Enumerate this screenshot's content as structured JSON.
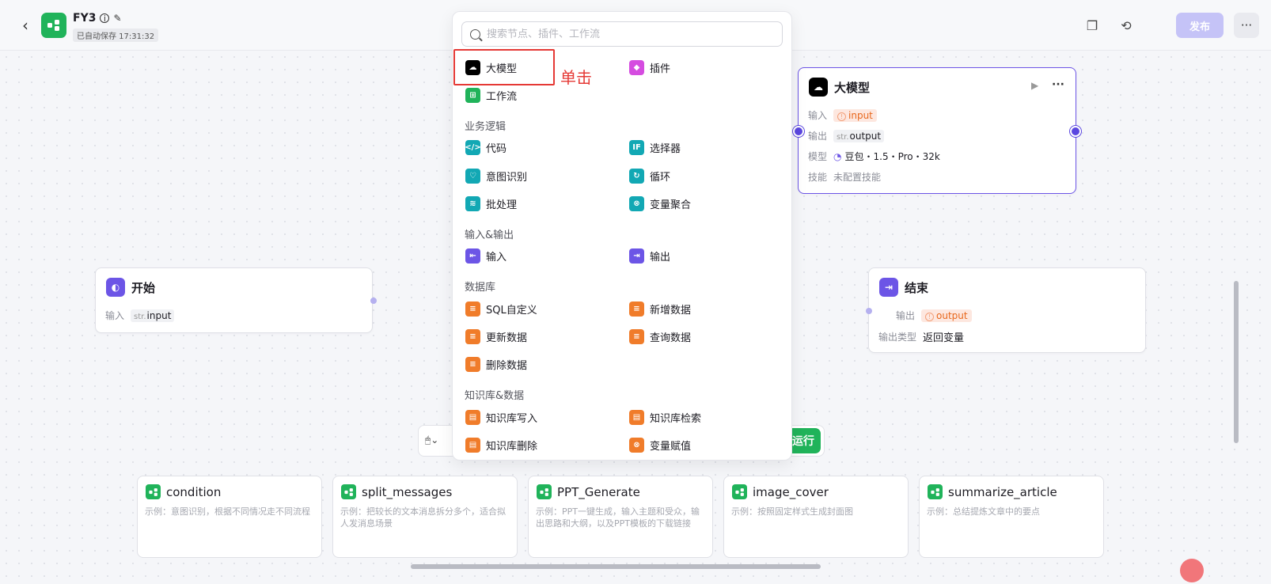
{
  "header": {
    "back_icon": "chevron-left-icon",
    "app_icon": "workflow-icon",
    "title": "FY3",
    "autosave": "已自动保存 17:31:32",
    "publish_label": "发布",
    "more_label": "···"
  },
  "search": {
    "placeholder": "搜索节点、插件、工作流"
  },
  "menu": {
    "top": [
      {
        "label": "大模型",
        "icon": "llm-icon",
        "color": "#000000"
      },
      {
        "label": "插件",
        "icon": "plugin-icon",
        "color": "#d54ce0"
      },
      {
        "label": "工作流",
        "icon": "workflow-icon",
        "color": "#20b35a"
      }
    ],
    "sections": [
      {
        "title": "业务逻辑",
        "items": [
          {
            "label": "代码",
            "icon": "code-icon",
            "color": "#12a8b4"
          },
          {
            "label": "选择器",
            "icon": "if-icon",
            "color": "#12a8b4"
          },
          {
            "label": "意图识别",
            "icon": "intent-icon",
            "color": "#12a8b4"
          },
          {
            "label": "循环",
            "icon": "loop-icon",
            "color": "#12a8b4"
          },
          {
            "label": "批处理",
            "icon": "batch-icon",
            "color": "#12a8b4"
          },
          {
            "label": "变量聚合",
            "icon": "variable-merge-icon",
            "color": "#12a8b4"
          }
        ]
      },
      {
        "title": "输入&输出",
        "items": [
          {
            "label": "输入",
            "icon": "input-icon",
            "color": "#6c55e6"
          },
          {
            "label": "输出",
            "icon": "output-icon",
            "color": "#6c55e6"
          }
        ]
      },
      {
        "title": "数据库",
        "items": [
          {
            "label": "SQL自定义",
            "icon": "database-icon",
            "color": "#f07c2a"
          },
          {
            "label": "新增数据",
            "icon": "database-add-icon",
            "color": "#f07c2a"
          },
          {
            "label": "更新数据",
            "icon": "database-update-icon",
            "color": "#f07c2a"
          },
          {
            "label": "查询数据",
            "icon": "database-query-icon",
            "color": "#f07c2a"
          },
          {
            "label": "删除数据",
            "icon": "database-delete-icon",
            "color": "#f07c2a"
          }
        ]
      },
      {
        "title": "知识库&数据",
        "items": [
          {
            "label": "知识库写入",
            "icon": "knowledge-write-icon",
            "color": "#f07c2a"
          },
          {
            "label": "知识库检索",
            "icon": "knowledge-search-icon",
            "color": "#f07c2a"
          },
          {
            "label": "知识库删除",
            "icon": "knowledge-delete-icon",
            "color": "#f07c2a"
          },
          {
            "label": "变量赋值",
            "icon": "variable-assign-icon",
            "color": "#f07c2a"
          }
        ]
      }
    ]
  },
  "annotation": {
    "label": "单击"
  },
  "nodes": {
    "start": {
      "title": "开始",
      "input_label": "输入",
      "input_type": "str.",
      "input_name": "input"
    },
    "llm": {
      "title": "大模型",
      "input_label": "输入",
      "input_name": "input",
      "output_label": "输出",
      "output_type": "str.",
      "output_name": "output",
      "model_label": "模型",
      "model_value": "豆包・1.5・Pro・32k",
      "skill_label": "技能",
      "skill_value": "未配置技能"
    },
    "end": {
      "title": "结束",
      "output_label": "输出",
      "output_name": "output",
      "type_label": "输出类型",
      "type_value": "返回变量"
    }
  },
  "toolbar": {
    "run_label": "运行"
  },
  "templates": [
    {
      "title": "condition",
      "desc": "示例：意图识别，根据不同情况走不同流程"
    },
    {
      "title": "split_messages",
      "desc": "示例：把较长的文本消息拆分多个，适合拟人发消息场景"
    },
    {
      "title": "PPT_Generate",
      "desc": "示例：PPT一键生成，输入主题和受众，输出思路和大纲，以及PPT模板的下载链接"
    },
    {
      "title": "image_cover",
      "desc": "示例：按照固定样式生成封面图"
    },
    {
      "title": "summarize_article",
      "desc": "示例：总结提炼文章中的要点"
    }
  ]
}
